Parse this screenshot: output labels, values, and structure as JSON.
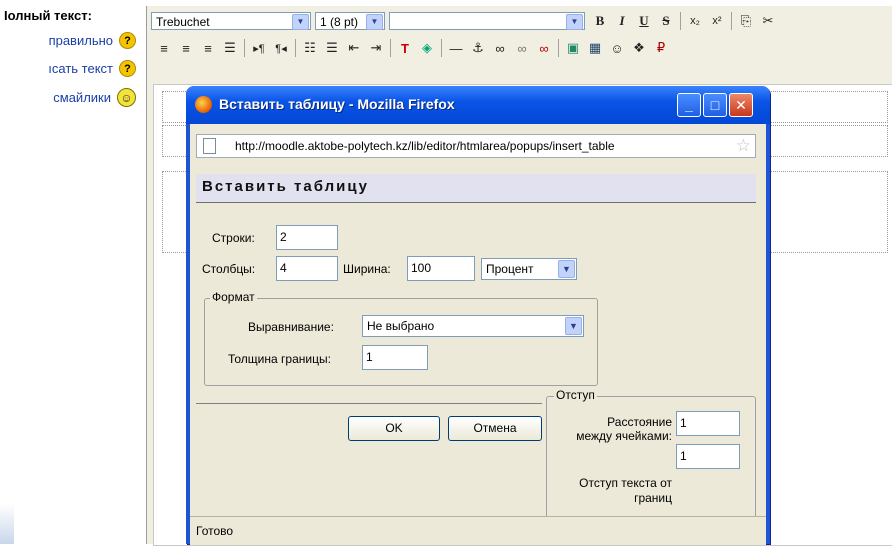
{
  "left_panel": {
    "title": "Iолный текст:",
    "help_lines": [
      "правильно",
      "ıсать текст",
      "смайлики"
    ]
  },
  "editor": {
    "font_name": "Trebuchet",
    "font_size": "1 (8 pt)",
    "format_select": "",
    "toolbar1_icons": [
      "bold-icon",
      "italic-icon",
      "underline-icon",
      "strikethrough-icon",
      "subscript-icon",
      "superscript-icon",
      "copy-icon",
      "cut-icon"
    ],
    "toolbar2_icons": [
      "align-left-icon",
      "align-center-icon",
      "align-right-icon",
      "justify-icon",
      "ltr-icon",
      "rtl-icon",
      "ordered-list-icon",
      "unordered-list-icon",
      "outdent-icon",
      "indent-icon",
      "text-color-icon",
      "background-color-icon",
      "horizontal-rule-icon",
      "anchor-icon",
      "link-icon",
      "unlink-icon",
      "nolink-icon",
      "image-icon",
      "table-icon",
      "smiley-icon",
      "special-char-icon",
      "paste-icon"
    ]
  },
  "dialog": {
    "window_title": "Вставить таблицу - Mozilla Firefox",
    "url": "http://moodle.aktobe-polytech.kz/lib/editor/htmlarea/popups/insert_table",
    "heading": "Вставить таблицу",
    "rows_label": "Строки:",
    "rows_value": "2",
    "cols_label": "Столбцы:",
    "cols_value": "4",
    "width_label": "Ширина:",
    "width_value": "100",
    "width_unit": "Процент",
    "format_legend": "Формат",
    "align_label": "Выравнивание:",
    "align_value": "Не выбрано",
    "border_label": "Толщина границы:",
    "border_value": "1",
    "spacing_legend": "Отступ",
    "cellspacing_label": "Расстояние между ячейками:",
    "cellspacing_value": "1",
    "cellspacing2_value": "1",
    "padding_label": "Отступ текста от границ",
    "ok_label": "OK",
    "cancel_label": "Отмена",
    "status": "Готово"
  }
}
